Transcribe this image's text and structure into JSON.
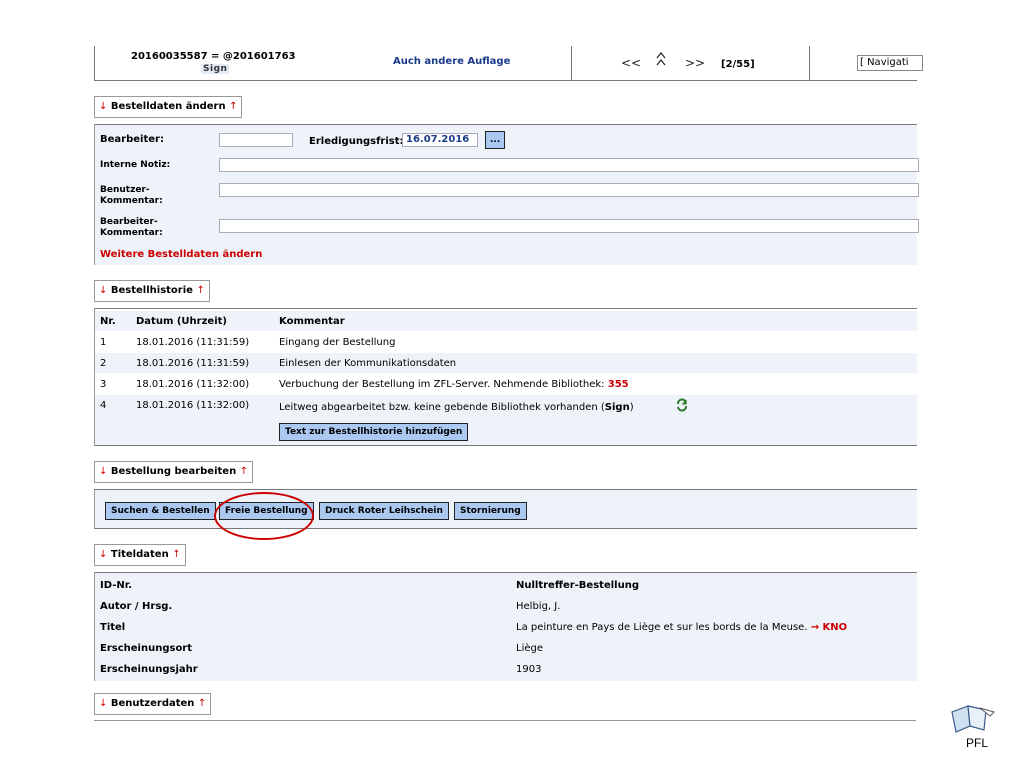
{
  "header": {
    "order_number": "20160035587 = @201601763",
    "sign": "Sign",
    "other_edition_link": "Auch andere Auflage",
    "nav_prev": "<<",
    "nav_up": "^",
    "nav_next": ">>",
    "counter": "[2/55]",
    "navigation_select": "[ Navigati"
  },
  "order_data": {
    "section_title": "Bestelldaten ändern",
    "arrow_down": "↓",
    "arrow_up": "↑",
    "editor_label": "Bearbeiter:",
    "editor_value": "",
    "deadline_label": "Erledigungsfrist:",
    "deadline_value": "16.07.2016",
    "date_picker_label": "...",
    "internal_note_label": "Interne Notiz:",
    "user_comment_label_1": "Benutzer-",
    "user_comment_label_2": "Kommentar:",
    "editor_comment_label_1": "Bearbeiter-",
    "editor_comment_label_2": "Kommentar:",
    "more_link": "Weitere Bestelldaten ändern"
  },
  "history": {
    "section_title": "Bestellhistorie",
    "columns": [
      "Nr.",
      "Datum (Uhrzeit)",
      "Kommentar"
    ],
    "rows": [
      {
        "nr": "1",
        "date": "18.01.2016 (11:31:59)",
        "comment": "Eingang der Bestellung"
      },
      {
        "nr": "2",
        "date": "18.01.2016 (11:31:59)",
        "comment": "Einlesen der Kommunikationsdaten"
      },
      {
        "nr": "3",
        "date": "18.01.2016 (11:32:00)",
        "comment": "Verbuchung der Bestellung im ZFL-Server. Nehmende Bibliothek: ",
        "comment_highlight": "355"
      },
      {
        "nr": "4",
        "date": "18.01.2016 (11:32:00)",
        "comment": "Leitweg abgearbeitet bzw. keine gebende Bibliothek vorhanden (",
        "comment_bold": "Sign",
        "comment_end": ")"
      }
    ],
    "add_button": "Text zur Bestellhistorie hinzufügen"
  },
  "edit_order": {
    "section_title": "Bestellung bearbeiten",
    "buttons": [
      "Suchen & Bestellen",
      "Freie Bestellung",
      "Druck Roter Leihschein",
      "Stornierung"
    ]
  },
  "title_data": {
    "section_title": "Titeldaten",
    "rows": [
      {
        "label": "ID-Nr.",
        "value": "Nulltreffer-Bestellung"
      },
      {
        "label": "Autor / Hrsg.",
        "value": "Helbig, J."
      },
      {
        "label": "Titel",
        "value": "La peinture en Pays de Liège et sur les bords de la Meuse.",
        "suffix": "→ KNO"
      },
      {
        "label": "Erscheinungsort",
        "value": "Liège"
      },
      {
        "label": "Erscheinungsjahr",
        "value": "1903"
      }
    ]
  },
  "user_data": {
    "section_title": "Benutzerdaten"
  },
  "logo": {
    "text": "PFL"
  },
  "colors": {
    "accent_red": "#cc0000",
    "button_blue": "#aac8f0",
    "panel_bg": "#eef3f9",
    "link_blue": "#1a3a8a"
  }
}
